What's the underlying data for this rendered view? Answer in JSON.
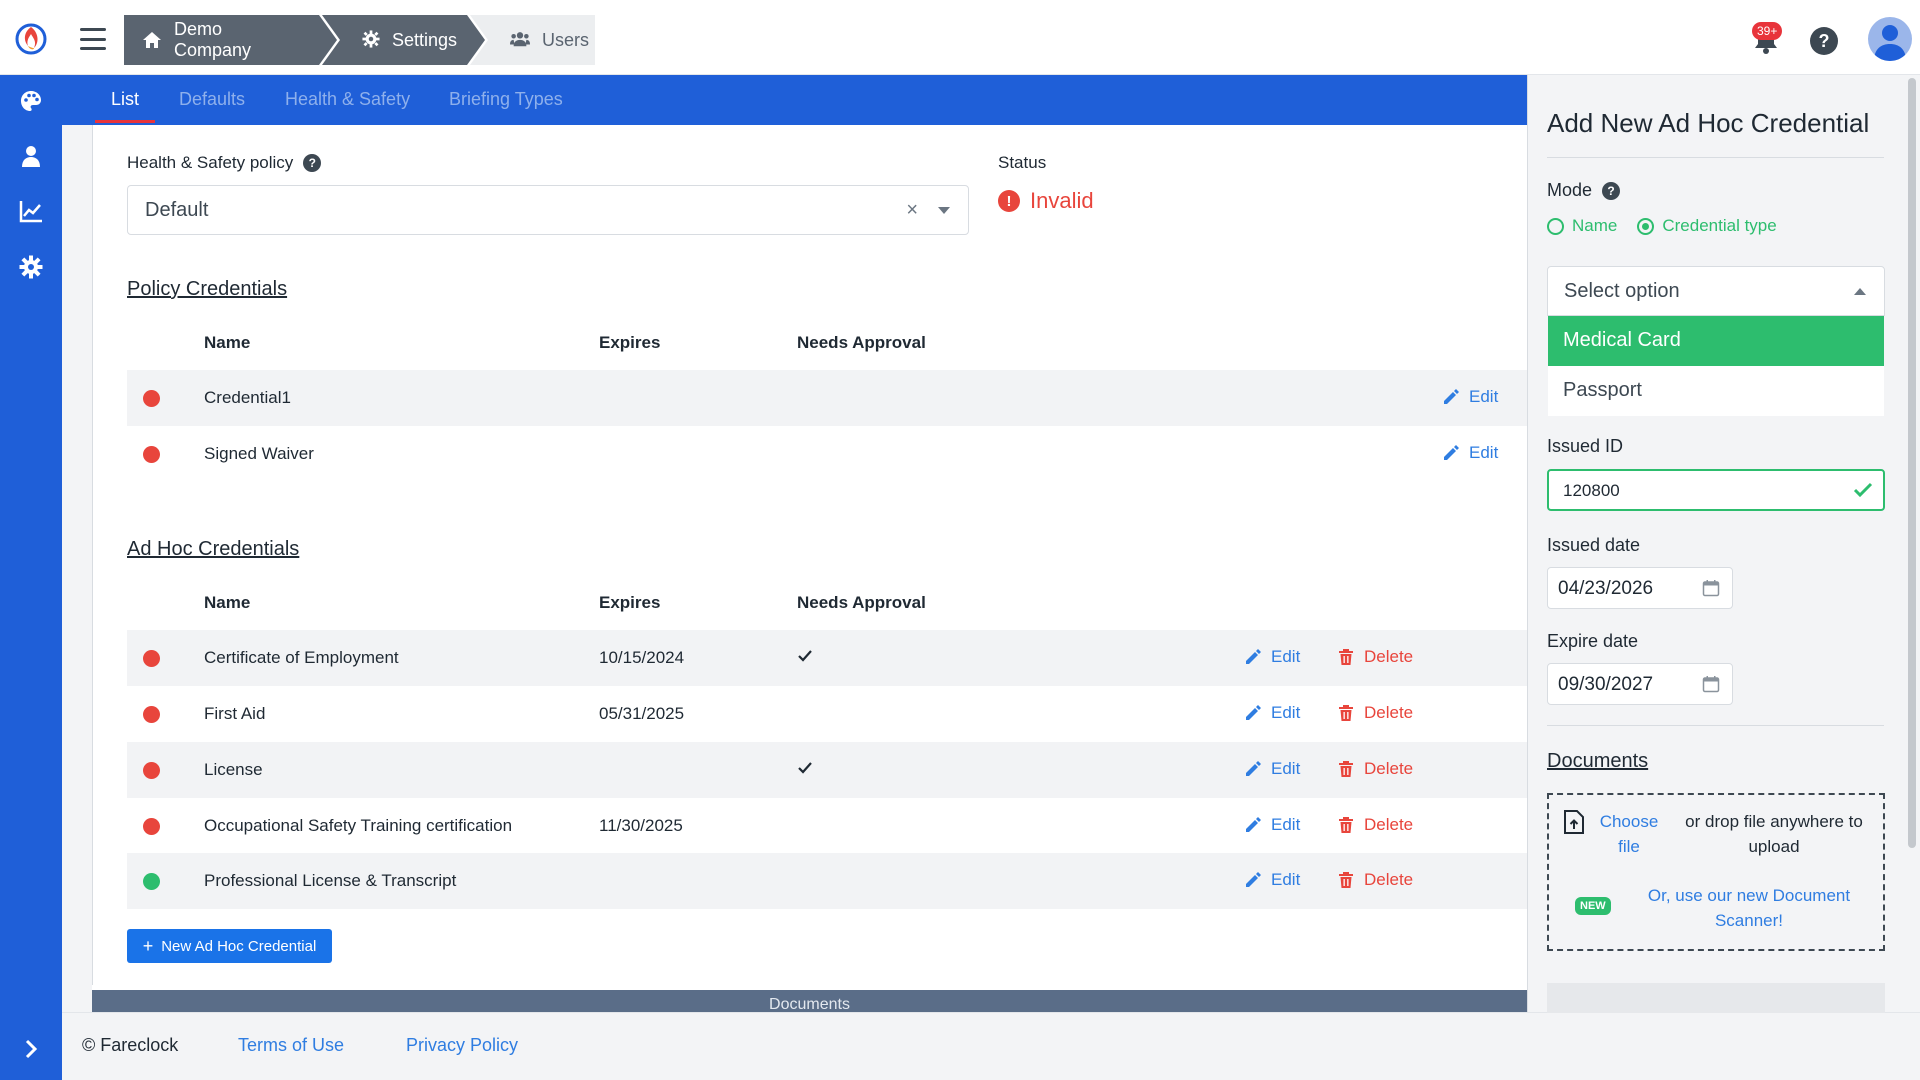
{
  "header": {
    "breadcrumbs": [
      {
        "label": "Demo Company",
        "icon": "home-icon"
      },
      {
        "label": "Settings",
        "icon": "gear-icon"
      },
      {
        "label": "Users",
        "icon": "users-icon"
      }
    ],
    "notification_count": "39+"
  },
  "tabs": [
    {
      "label": "List",
      "active": true
    },
    {
      "label": "Defaults",
      "active": false
    },
    {
      "label": "Health & Safety",
      "active": false
    },
    {
      "label": "Briefing Types",
      "active": false
    }
  ],
  "policy": {
    "label": "Health & Safety policy",
    "value": "Default",
    "clear_glyph": "×"
  },
  "status": {
    "label": "Status",
    "value": "Invalid"
  },
  "policy_credentials": {
    "title": "Policy Credentials",
    "columns": [
      "Name",
      "Expires",
      "Needs Approval"
    ],
    "rows": [
      {
        "name": "Credential1",
        "expires": "",
        "needs_approval": false,
        "status": "invalid",
        "edit": "Edit"
      },
      {
        "name": "Signed Waiver",
        "expires": "",
        "needs_approval": false,
        "status": "invalid",
        "edit": "Edit"
      }
    ]
  },
  "adhoc_credentials": {
    "title": "Ad Hoc Credentials",
    "columns": [
      "Name",
      "Expires",
      "Needs Approval"
    ],
    "rows": [
      {
        "name": "Certificate of Employment",
        "expires": "10/15/2024",
        "needs_approval": true,
        "status": "invalid",
        "edit": "Edit",
        "delete": "Delete"
      },
      {
        "name": "First Aid",
        "expires": "05/31/2025",
        "needs_approval": false,
        "status": "invalid",
        "edit": "Edit",
        "delete": "Delete"
      },
      {
        "name": "License",
        "expires": "",
        "needs_approval": true,
        "status": "invalid",
        "edit": "Edit",
        "delete": "Delete"
      },
      {
        "name": "Occupational Safety Training certification",
        "expires": "11/30/2025",
        "needs_approval": false,
        "status": "invalid",
        "edit": "Edit",
        "delete": "Delete"
      },
      {
        "name": "Professional License & Transcript",
        "expires": "",
        "needs_approval": false,
        "status": "valid",
        "edit": "Edit",
        "delete": "Delete"
      }
    ],
    "new_button": "New Ad Hoc Credential"
  },
  "documents_strip": "Documents",
  "footer": {
    "copyright": "© Fareclock",
    "terms": "Terms of Use",
    "privacy": "Privacy Policy"
  },
  "panel": {
    "title": "Add New Ad Hoc Credential",
    "mode_label": "Mode",
    "mode_options": [
      {
        "label": "Name",
        "selected": false
      },
      {
        "label": "Credential type",
        "selected": true
      }
    ],
    "select_placeholder": "Select option",
    "options": [
      {
        "label": "Medical Card",
        "highlighted": true
      },
      {
        "label": "Passport",
        "highlighted": false
      }
    ],
    "issued_id_label": "Issued ID",
    "issued_id_value": "120800",
    "issued_date_label": "Issued date",
    "issued_date_value": "04/23/2026",
    "expire_date_label": "Expire date",
    "expire_date_value": "09/30/2027",
    "documents_title": "Documents",
    "choose_file": "Choose file",
    "drop_text": "or drop file anywhere to upload",
    "new_badge": "NEW",
    "scanner_link": "Or, use our new Document Scanner!"
  },
  "colors": {
    "brand_blue": "#1f5fd8",
    "accent_green": "#2dbd6e",
    "error_red": "#e8453c",
    "link_blue": "#2f7de1"
  }
}
